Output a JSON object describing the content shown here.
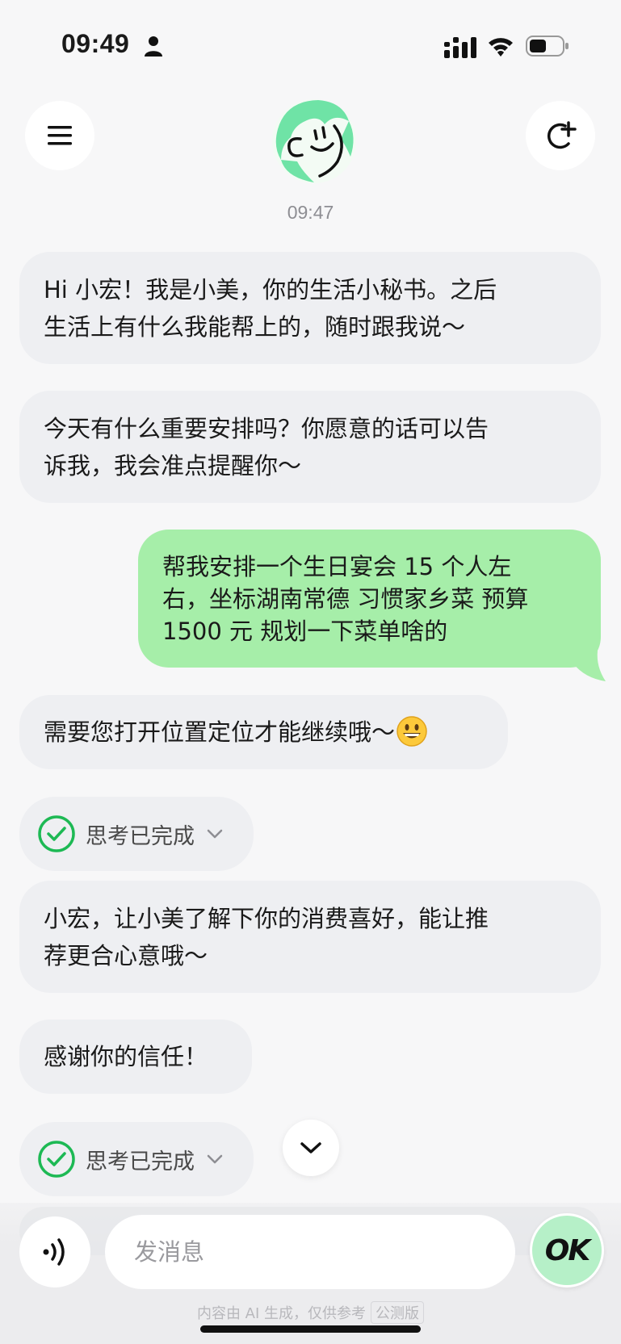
{
  "status_bar": {
    "time": "09:49"
  },
  "header": {
    "time": "09:47"
  },
  "messages": {
    "m1": {
      "line1": "Hi 小宏！我是小美，你的生活小秘书。之后",
      "line2": "生活上有什么我能帮上的，随时跟我说～"
    },
    "m2": {
      "line1": "今天有什么重要安排吗？你愿意的话可以告",
      "line2": "诉我，我会准点提醒你～"
    },
    "user": {
      "line1": "帮我安排一个生日宴会 15 个人左",
      "line2": "右，坐标湖南常德 习惯家乡菜 预算",
      "line3": "1500 元 规划一下菜单啥的"
    },
    "m4": {
      "text": "需要您打开位置定位才能继续哦～"
    },
    "think1": {
      "label": "思考已完成"
    },
    "m5": {
      "line1": "小宏，让小美了解下你的消费喜好，能让推",
      "line2": "荐更合心意哦～"
    },
    "m6": {
      "text": "感谢你的信任！"
    },
    "think2": {
      "label": "思考已完成"
    }
  },
  "input": {
    "placeholder": "发消息",
    "ok_label": "OK"
  },
  "footer": {
    "disclaimer": "内容由 AI 生成，仅供参考",
    "beta": "公测版"
  },
  "colors": {
    "user_bubble": "#a6eea9",
    "bot_bubble": "#eeeff2",
    "check_green": "#1db954",
    "ok_button": "#b6f0c8"
  }
}
